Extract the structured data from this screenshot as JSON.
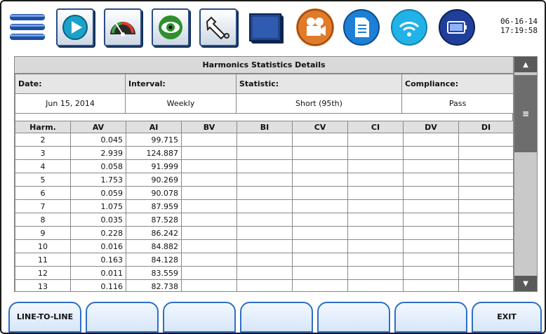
{
  "clock": {
    "date": "06-16-14",
    "time": "17:19:58"
  },
  "toolbar": {
    "icons": [
      "menu-icon",
      "play-icon",
      "gauge-icon",
      "eye-icon",
      "wrench-icon",
      "monitor-icon",
      "camera-icon",
      "report-icon",
      "wifi-icon",
      "battery-icon"
    ]
  },
  "panel": {
    "title": "Harmonics Statistics Details",
    "date_label": "Date:",
    "interval_label": "Interval:",
    "statistic_label": "Statistic:",
    "compliance_label": "Compliance:",
    "date_value": "Jun 15, 2014",
    "interval_value": "Weekly",
    "statistic_value": "Short (95th)",
    "compliance_value": "Pass"
  },
  "table": {
    "headers": [
      "Harm.",
      "AV",
      "AI",
      "BV",
      "BI",
      "CV",
      "CI",
      "DV",
      "DI"
    ],
    "rows": [
      [
        "2",
        "0.045",
        "99.715",
        "",
        "",
        "",
        "",
        "",
        ""
      ],
      [
        "3",
        "2.939",
        "124.887",
        "",
        "",
        "",
        "",
        "",
        ""
      ],
      [
        "4",
        "0.058",
        "91.999",
        "",
        "",
        "",
        "",
        "",
        ""
      ],
      [
        "5",
        "1.753",
        "90.269",
        "",
        "",
        "",
        "",
        "",
        ""
      ],
      [
        "6",
        "0.059",
        "90.078",
        "",
        "",
        "",
        "",
        "",
        ""
      ],
      [
        "7",
        "1.075",
        "87.959",
        "",
        "",
        "",
        "",
        "",
        ""
      ],
      [
        "8",
        "0.035",
        "87.528",
        "",
        "",
        "",
        "",
        "",
        ""
      ],
      [
        "9",
        "0.228",
        "86.242",
        "",
        "",
        "",
        "",
        "",
        ""
      ],
      [
        "10",
        "0.016",
        "84.882",
        "",
        "",
        "",
        "",
        "",
        ""
      ],
      [
        "11",
        "0.163",
        "84.128",
        "",
        "",
        "",
        "",
        "",
        ""
      ],
      [
        "12",
        "0.011",
        "83.559",
        "",
        "",
        "",
        "",
        "",
        ""
      ],
      [
        "13",
        "0.116",
        "82.738",
        "",
        "",
        "",
        "",
        "",
        ""
      ]
    ]
  },
  "softkeys": [
    "LINE-TO-LINE",
    "",
    "",
    "",
    "",
    "",
    "EXIT"
  ],
  "colors": {
    "pass": "#22a02a",
    "softkey_border": "#2d6fc6",
    "toolbar_blue": "#1f4fa0"
  }
}
